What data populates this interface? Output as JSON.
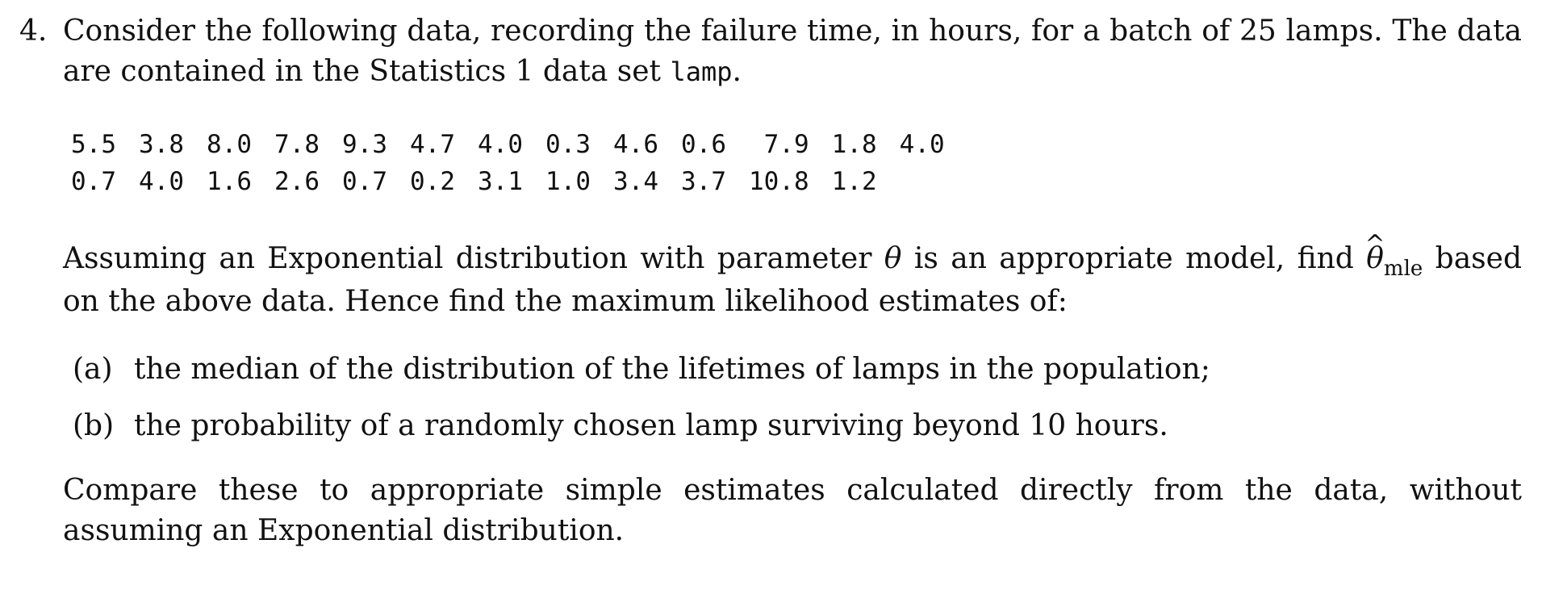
{
  "problem": {
    "number": "4.",
    "intro_pre": "Consider the following data, recording the failure time, in hours, for a batch of 25 lamps. The data are contained in the Statistics 1 data set ",
    "dataset_name": "lamp",
    "intro_post": ".",
    "data_rows": [
      [
        "5.5",
        "3.8",
        "8.0",
        "7.8",
        "9.3",
        "4.7",
        "4.0",
        "0.3",
        "4.6",
        "0.6",
        "7.9",
        "1.8",
        "4.0"
      ],
      [
        "0.7",
        "4.0",
        "1.6",
        "2.6",
        "0.7",
        "0.2",
        "3.1",
        "1.0",
        "3.4",
        "3.7",
        "10.8",
        "1.2"
      ]
    ],
    "assume_pre": "Assuming an Exponential distribution with parameter ",
    "theta_symbol": "θ",
    "assume_mid": " is an appropriate model, find ",
    "theta_hat_symbol": "θ",
    "hat_symbol": "^",
    "theta_hat_subscript": "mle",
    "assume_post": " based on the above data. Hence find the maximum likelihood estimates of:",
    "parts": [
      {
        "label": "(a)",
        "text": "the median of the distribution of the lifetimes of lamps in the population;"
      },
      {
        "label": "(b)",
        "text": "the probability of a randomly chosen lamp surviving beyond 10 hours."
      }
    ],
    "compare_text": "Compare these to appropriate simple estimates calculated directly from the data, without assuming an Exponential distribution."
  }
}
